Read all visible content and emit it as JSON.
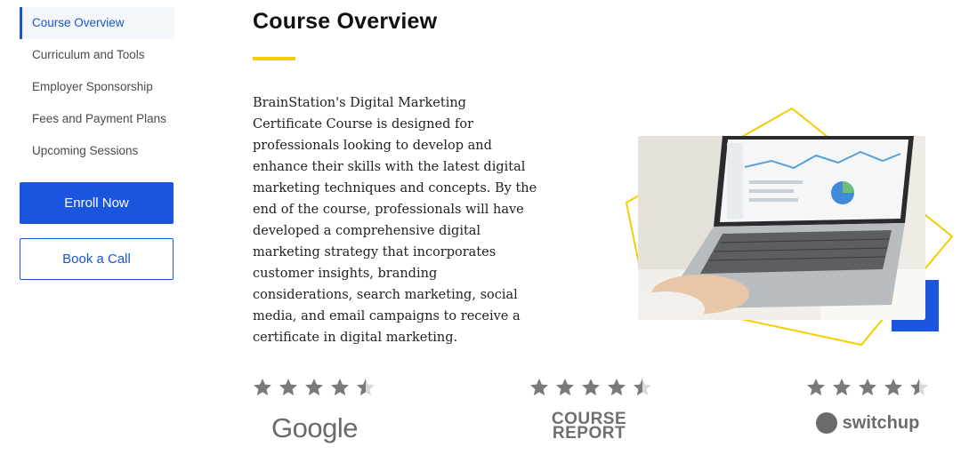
{
  "sidebar": {
    "items": [
      {
        "label": "Course Overview",
        "active": true
      },
      {
        "label": "Curriculum and Tools",
        "active": false
      },
      {
        "label": "Employer Sponsorship",
        "active": false
      },
      {
        "label": "Fees and Payment Plans",
        "active": false
      },
      {
        "label": "Upcoming Sessions",
        "active": false
      }
    ],
    "enroll_label": "Enroll Now",
    "call_label": "Book a Call"
  },
  "main": {
    "title": "Course Overview",
    "description": "BrainStation's Digital Marketing Certificate Course is designed for professionals looking to develop and enhance their skills with the latest digital marketing techniques and concepts. By the end of the course, professionals will have developed a comprehensive digital marketing strategy that incorporates customer insights, branding considerations, search marketing, social media, and email campaigns to receive a certificate in digital marketing."
  },
  "ratings": [
    {
      "source": "Google",
      "stars": 4.5
    },
    {
      "source_line1": "COURSE",
      "source_line2": "REPORT",
      "stars": 4.5
    },
    {
      "source": "switchup",
      "stars": 4.5
    }
  ],
  "colors": {
    "accent": "#1a55e0",
    "underline": "#f5cc00",
    "star": "#7a7a7a"
  }
}
